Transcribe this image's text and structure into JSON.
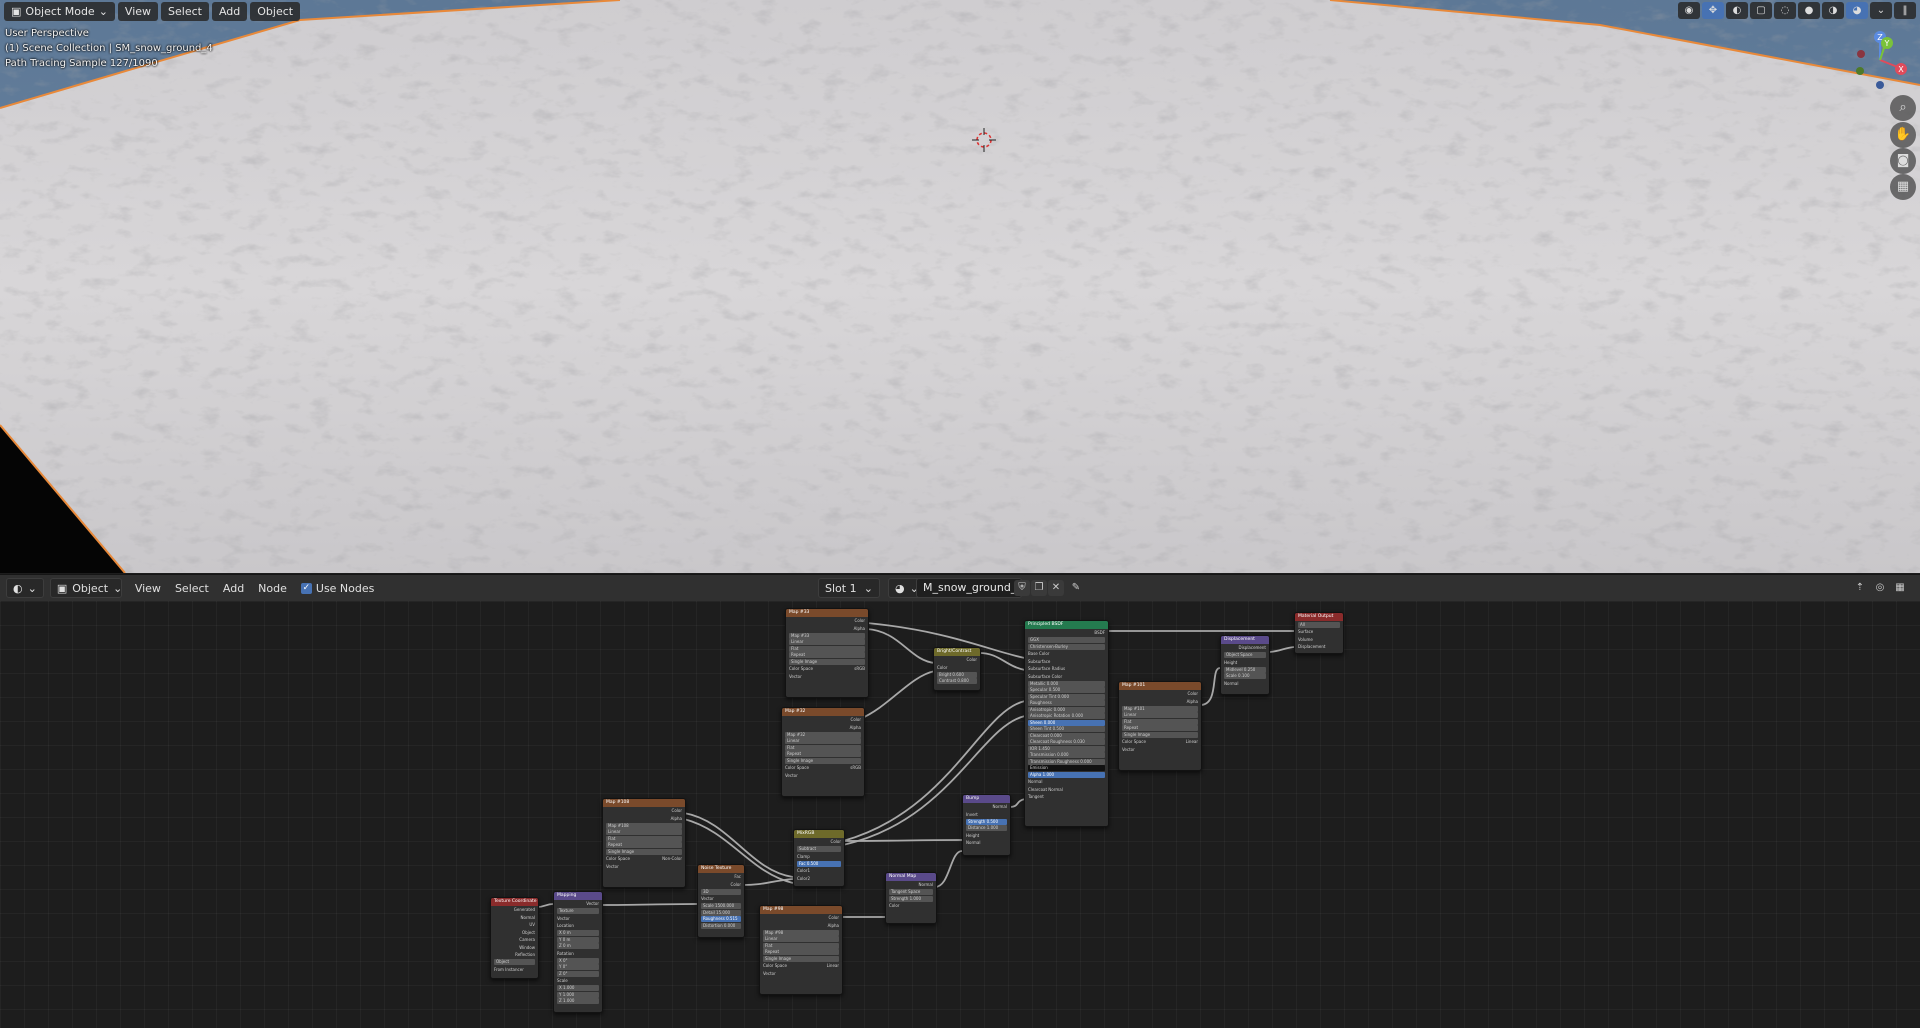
{
  "viewport": {
    "mode": "Object Mode",
    "menu": [
      "View",
      "Select",
      "Add",
      "Object"
    ],
    "overlay_lines": [
      "User Perspective",
      "(1) Scene Collection | SM_snow_ground_4",
      "Path Tracing Sample 127/1090"
    ],
    "gizmo_axes": [
      "Z",
      "Y",
      "X"
    ]
  },
  "node_editor": {
    "editor_type": "Object",
    "menu": [
      "View",
      "Select",
      "Add",
      "Node"
    ],
    "use_nodes_label": "Use Nodes",
    "slot": "Slot 1",
    "material_name": "M_snow_ground_4"
  },
  "nodes": {
    "tex_coord": {
      "title": "Texture Coordinate",
      "outputs": [
        "Generated",
        "Normal",
        "UV",
        "Object",
        "Camera",
        "Window",
        "Reflection"
      ],
      "object_label": "Object",
      "instancer": "From Instancer"
    },
    "mapping": {
      "title": "Mapping",
      "out": "Vector",
      "type_label": "Type:",
      "type_value": "Texture",
      "in_vector": "Vector",
      "location": "Location",
      "loc": [
        "X 0 m",
        "Y 0 m",
        "Z 0 m"
      ],
      "rotation": "Rotation",
      "rot": [
        "X 0°",
        "Y 0°",
        "Z 0°"
      ],
      "scale": "Scale",
      "scl": [
        "X 1.000",
        "Y 1.000",
        "Z 1.000"
      ]
    },
    "img_top": {
      "title": "Map #33",
      "outs": [
        "Color",
        "Alpha"
      ],
      "img": "Map #33",
      "opts": [
        "Linear",
        "Flat",
        "Repeat",
        "Single Image"
      ],
      "cs_label": "Color Space",
      "cs_value": "sRGB",
      "vec": "Vector"
    },
    "img_mid": {
      "title": "Map #32",
      "outs": [
        "Color",
        "Alpha"
      ],
      "img": "Map #32",
      "opts": [
        "Linear",
        "Flat",
        "Repeat",
        "Single Image"
      ],
      "cs_label": "Color Space",
      "cs_value": "sRGB",
      "vec": "Vector"
    },
    "img_left": {
      "title": "Map #108",
      "outs": [
        "Color",
        "Alpha"
      ],
      "img": "Map #108",
      "opts": [
        "Linear",
        "Flat",
        "Repeat",
        "Single Image"
      ],
      "cs_label": "Color Space",
      "cs_value": "Non-Color",
      "vec": "Vector"
    },
    "img_bottom": {
      "title": "Map #98",
      "outs": [
        "Color",
        "Alpha"
      ],
      "img": "Map #98",
      "opts": [
        "Linear",
        "Flat",
        "Repeat",
        "Single Image"
      ],
      "cs_label": "Color Space",
      "cs_value": "Linear",
      "vec": "Vector"
    },
    "img_right": {
      "title": "Map #101",
      "outs": [
        "Color",
        "Alpha"
      ],
      "img": "Map #101",
      "opts": [
        "Linear",
        "Flat",
        "Repeat",
        "Single Image"
      ],
      "cs_label": "Color Space",
      "cs_value": "Linear",
      "vec": "Vector"
    },
    "noise": {
      "title": "Noise Texture",
      "outs": [
        "Fac",
        "Color"
      ],
      "dim": "3D",
      "vec": "Vector",
      "fields": [
        "Scale 1500.000",
        "Detail 15.000",
        "Roughness 0.515",
        "Distortion 0.000"
      ]
    },
    "mix": {
      "title": "MixRGB",
      "out": "Color",
      "blend": "Subtract",
      "clamp": "Clamp",
      "fac": "Fac 0.500",
      "ins": [
        "Color1",
        "Color2"
      ]
    },
    "bright": {
      "title": "Bright/Contrast",
      "out": "Color",
      "in": "Color",
      "fields": [
        "Bright 0.600",
        "Contrast 0.800"
      ]
    },
    "bump": {
      "title": "Bump",
      "out": "Normal",
      "invert": "Invert",
      "fields": [
        "Strength 0.500",
        "Distance 1.000"
      ],
      "ins": [
        "Height",
        "Normal"
      ]
    },
    "normal_map": {
      "title": "Normal Map",
      "out": "Normal",
      "space": "Tangent Space",
      "strength": "Strength 1.000",
      "in": "Color"
    },
    "bsdf": {
      "title": "Principled BSDF",
      "out": "BSDF",
      "dist": "GGX",
      "sss": "Christensen-Burley",
      "rows": [
        "Base Color",
        "Subsurface",
        "Subsurface Radius",
        "Subsurface Color",
        "Metallic 0.000",
        "Specular 0.500",
        "Specular Tint 0.000",
        "Roughness",
        "Anisotropic 0.000",
        "Anisotropic Rotation 0.000",
        "Sheen 0.000",
        "Sheen Tint 0.500",
        "Clearcoat 0.000",
        "Clearcoat Roughness 0.030",
        "IOR 1.450",
        "Transmission 0.000",
        "Transmission Roughness 0.000",
        "Emission",
        "Alpha 1.000",
        "Normal",
        "Clearcoat Normal",
        "Tangent"
      ]
    },
    "displacement": {
      "title": "Displacement",
      "out": "Displacement",
      "space": "Object Space",
      "height": "Height",
      "fields": [
        "Midlevel 0.250",
        "Scale 0.100"
      ],
      "normal": "Normal"
    },
    "output": {
      "title": "Material Output",
      "target": "All",
      "ins": [
        "Surface",
        "Volume",
        "Displacement"
      ]
    }
  },
  "colors": {
    "accent": "#4772b3",
    "selection_outline": "#e8893a",
    "viewport_sky": "#6f8aa6",
    "snow": "#d6d4d6"
  }
}
